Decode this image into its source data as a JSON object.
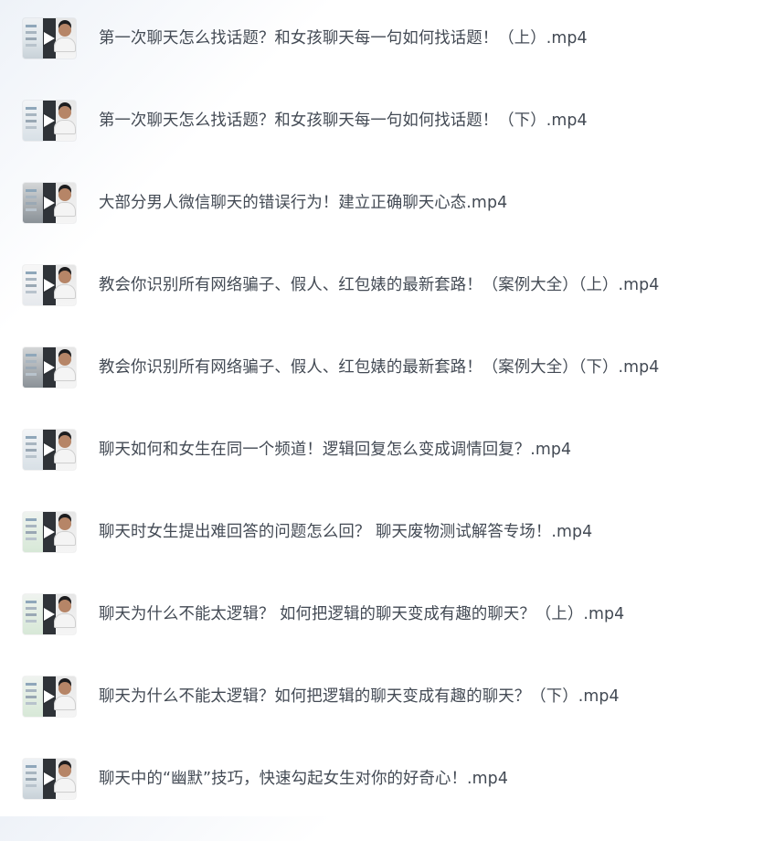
{
  "files": [
    {
      "name": "第一次聊天怎么找话题？和女孩聊天每一句如何找话题！（上）.mp4",
      "icon": "video-thumbnail-icon"
    },
    {
      "name": "第一次聊天怎么找话题？和女孩聊天每一句如何找话题！（下）.mp4",
      "icon": "video-thumbnail-icon"
    },
    {
      "name": "大部分男人微信聊天的错误行为！建立正确聊天心态.mp4",
      "icon": "video-thumbnail-icon"
    },
    {
      "name": "教会你识别所有网络骗子、假人、红包婊的最新套路！（案例大全）（上）.mp4",
      "icon": "video-thumbnail-icon"
    },
    {
      "name": "教会你识别所有网络骗子、假人、红包婊的最新套路！（案例大全）（下）.mp4",
      "icon": "video-thumbnail-icon"
    },
    {
      "name": "聊天如何和女生在同一个频道！逻辑回复怎么变成调情回复？.mp4",
      "icon": "video-thumbnail-icon"
    },
    {
      "name": "聊天时女生提出难回答的问题怎么回？ 聊天废物测试解答专场！.mp4",
      "icon": "video-thumbnail-icon"
    },
    {
      "name": "聊天为什么不能太逻辑？ 如何把逻辑的聊天变成有趣的聊天？（上）.mp4",
      "icon": "video-thumbnail-icon"
    },
    {
      "name": "聊天为什么不能太逻辑？如何把逻辑的聊天变成有趣的聊天？（下）.mp4",
      "icon": "video-thumbnail-icon"
    },
    {
      "name": "聊天中的“幽默”技巧，快速勾起女生对你的好奇心！.mp4",
      "icon": "video-thumbnail-icon"
    }
  ]
}
